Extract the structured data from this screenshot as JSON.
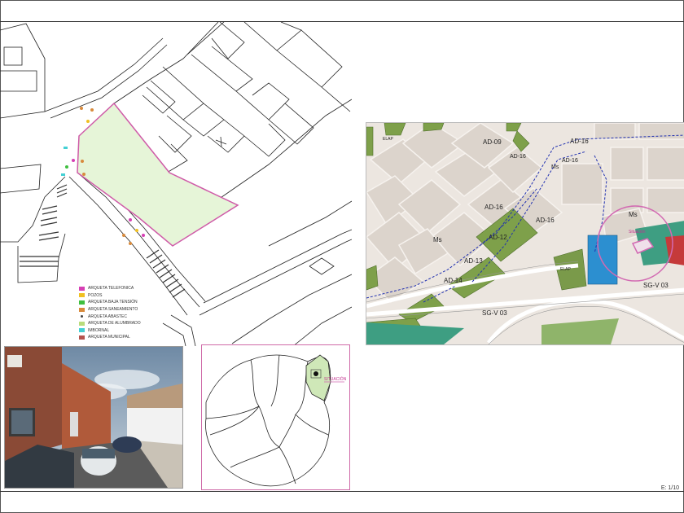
{
  "legend": {
    "items": [
      {
        "label": "ARQUETA TELEFONICA",
        "color": "#d63fb4"
      },
      {
        "label": "POZOS",
        "color": "#f0c022"
      },
      {
        "label": "ARQUETA BAJA TENSIÓN",
        "color": "#3fbf3f"
      },
      {
        "label": "ARQUETA SANEAMIENTO",
        "color": "#d88a3c"
      },
      {
        "label": "ARQUETA ABASTEC",
        "color": "#444444"
      },
      {
        "label": "ARQUETA DE ALUMBRADO",
        "color": "#b9dc7c"
      },
      {
        "label": "IMBORNAL",
        "color": "#43d0d4"
      },
      {
        "label": "ARQUETA MUNICIPAL",
        "color": "#b5534e"
      }
    ]
  },
  "zoning": {
    "labels": {
      "ad09": "AD-09",
      "ad16_top": "AD-16",
      "ad16_a": "AD-16",
      "ad16_b": "AD-16",
      "ad16_c": "AD-16",
      "ad16_d": "AD-16",
      "ad12": "AD-12",
      "ad13": "AD-13",
      "ad14": "AD-14",
      "ms_left": "Ms",
      "ms_right": "Ms",
      "ms_mid": "Ms",
      "elap_top": "ELAP",
      "elap_mid": "ELAP",
      "sgv_bottom": "SG-V 03",
      "sgv_right": "SG-V 03",
      "situacion": "Situación"
    }
  },
  "locator": {
    "situacion_label": "SITUACIÓN"
  },
  "footer": {
    "scale": "E: 1/10"
  },
  "colors": {
    "plot_fill": "#e6f5d8",
    "plot_border": "#cf5ba8",
    "zone_green": "#7ea04a",
    "zone_blue": "#2c8fd0",
    "zone_teal": "#3e9e82"
  }
}
